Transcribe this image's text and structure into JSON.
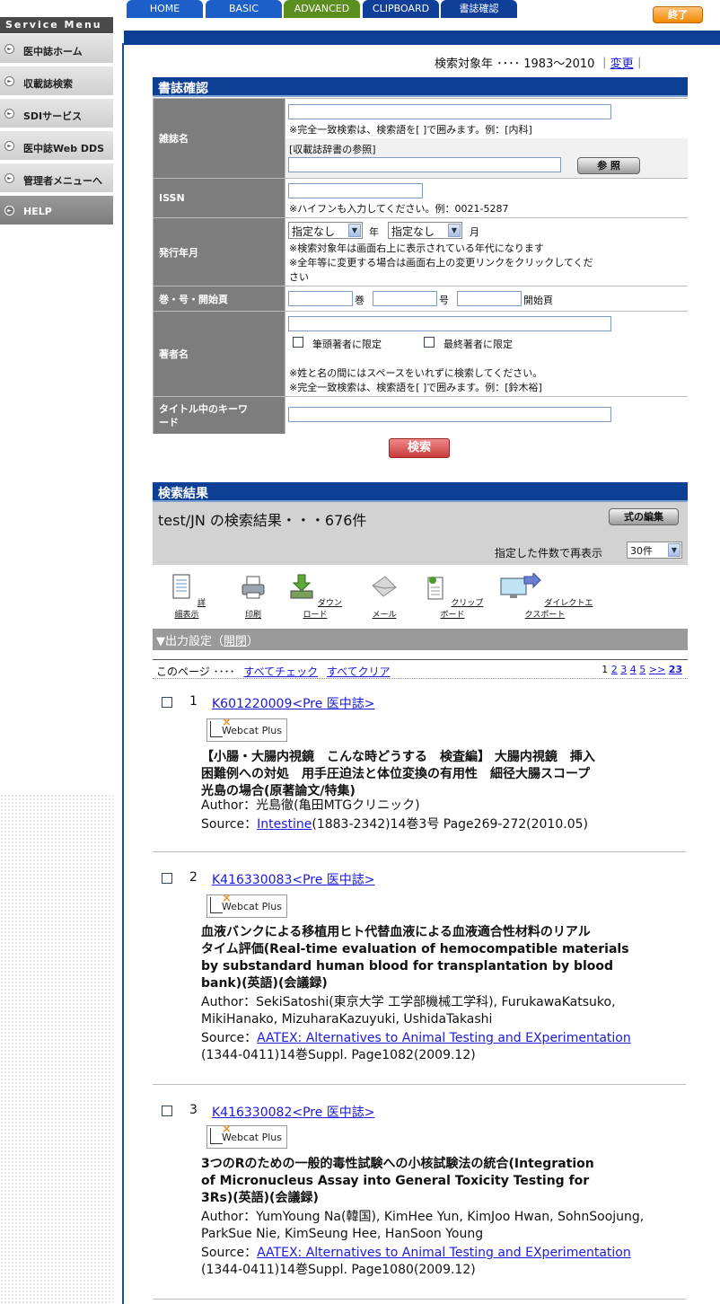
{
  "sidebar": {
    "title": "Service Menu",
    "items": [
      {
        "label": "医中誌ホーム"
      },
      {
        "label": "収載誌検索"
      },
      {
        "label": "SDIサービス"
      },
      {
        "label": "医中誌Web DDS"
      },
      {
        "label": "管理者メニューへ"
      },
      {
        "label": "HELP"
      }
    ]
  },
  "tabs": [
    {
      "label": "HOME",
      "color": "#1c5fc9"
    },
    {
      "label": "BASIC",
      "color": "#1c5fc9"
    },
    {
      "label": "ADVANCED",
      "color": "#5a8f1f"
    },
    {
      "label": "CLIPBOARD",
      "color": "#0f3f99"
    },
    {
      "label": "書誌確認",
      "color": "#0f3f99"
    }
  ],
  "exit_label": "終了",
  "year": {
    "label": "検索対象年 ････ 1983～2010 ｜",
    "change_link": "変更",
    "end": "｜"
  },
  "biblio": {
    "title": "書誌確認",
    "journal": {
      "label": "雑誌名",
      "note": "※完全一致検索は、検索語を[ ]で囲みます。例：[内科]",
      "dict_label": "[収載誌辞書の参照]",
      "browse_button": "参 照"
    },
    "issn": {
      "label": "ISSN",
      "note": "※ハイフンも入力してください。例：0021-5287"
    },
    "pubdate": {
      "label": "発行年月",
      "year_select": "指定なし",
      "year_suffix": "年",
      "month_select": "指定なし",
      "month_suffix": "月",
      "note1": "※検索対象年は画面右上に表示されている年代になります",
      "note2": "※全年等に変更する場合は画面右上の変更リンクをクリックしてくだ",
      "note3": "さい"
    },
    "volume": {
      "label": "巻・号・開始頁",
      "vol_suffix": "巻",
      "issue_suffix": "号",
      "page_suffix": "開始頁"
    },
    "author": {
      "label": "著者名",
      "first_author": "筆頭著者に限定",
      "last_author": "最終著者に限定",
      "note1": "※姓と名の間にはスペースをいれずに検索してください。",
      "note2": "※完全一致検索は、検索語を[ ]で囲みます。例：[鈴木裕]"
    },
    "keyword": {
      "label_line1": "タイトル中のキーワ",
      "label_line2": "ード"
    },
    "search_button": "検索"
  },
  "results": {
    "title": "検索結果",
    "summary": "test/JN の検索結果・・・676件",
    "edit_button": "式の編集",
    "redisplay_label": "指定した件数で再表示",
    "count_select": "30件",
    "toolbar": [
      {
        "label": "詳細表示",
        "icon": "document-icon"
      },
      {
        "label": "印刷",
        "icon": "printer-icon"
      },
      {
        "label": "ダウンロード",
        "icon": "download-icon"
      },
      {
        "label": "メール",
        "icon": "mail-icon"
      },
      {
        "label": "クリップボード",
        "icon": "clipboard-icon"
      },
      {
        "label": "ダイレクトエクスポート",
        "icon": "export-icon"
      }
    ],
    "output_settings": "▼出力設定（",
    "output_toggle": "開閉",
    "output_close": "）",
    "page_label": "このページ ････",
    "check_all": "すべてチェック",
    "clear_all": "すべてクリア",
    "pages": [
      "1",
      "2",
      "3",
      "4",
      "5",
      ">>",
      "23"
    ]
  },
  "records": [
    {
      "num": "1",
      "id_link": "K601220009<Pre 医中誌>",
      "badge": "Webcat Plus",
      "title_lines": [
        "【小腸・大腸内視鏡　こんな時どうする　検査編】 大腸内視鏡　挿入",
        "困難例への対処　用手圧迫法と体位変換の有用性　細径大腸スコープ",
        "光島の場合(原著論文/特集)"
      ],
      "author_label": "Author：",
      "author": "光島徹(亀田MTGクリニック)",
      "source_label": "Source：",
      "journal": "Intestine",
      "source_rest": "(1883-2342)14巻3号 Page269-272(2010.05)"
    },
    {
      "num": "2",
      "id_link": "K416330083<Pre 医中誌>",
      "badge": "Webcat Plus",
      "title_lines": [
        "血液バンクによる移植用ヒト代替血液による血液適合性材料のリアル",
        "タイム評価(Real-time evaluation of hemocompatible materials",
        "by substandard human blood for transplantation by blood",
        "bank)(英語)(会議録)"
      ],
      "author_label": "Author：",
      "author_lines": [
        "SekiSatoshi(東京大学 工学部機械工学科), FurukawaKatsuko,",
        "MikiHanako, MizuharaKazuyuki, UshidaTakashi"
      ],
      "source_label": "Source：",
      "journal": "AATEX: Alternatives to Animal Testing and EXperimentation",
      "source_rest": "(1344-0411)14巻Suppl. Page1082(2009.12)"
    },
    {
      "num": "3",
      "id_link": "K416330082<Pre 医中誌>",
      "badge": "Webcat Plus",
      "title_lines": [
        "3つのRのための一般的毒性試験への小核試験法の統合(Integration",
        "of Micronucleus Assay into General Toxicity Testing for",
        "3Rs)(英語)(会議録)"
      ],
      "author_label": "Author：",
      "author_lines": [
        "YumYoung Na(韓国), KimHee Yun, KimJoo Hwan, SohnSoojung,",
        "ParkSue Nie, KimSeung Hee, HanSoon Young"
      ],
      "source_label": "Source：",
      "journal": "AATEX: Alternatives to Animal Testing and EXperimentation",
      "source_rest": "(1344-0411)14巻Suppl. Page1080(2009.12)"
    }
  ]
}
